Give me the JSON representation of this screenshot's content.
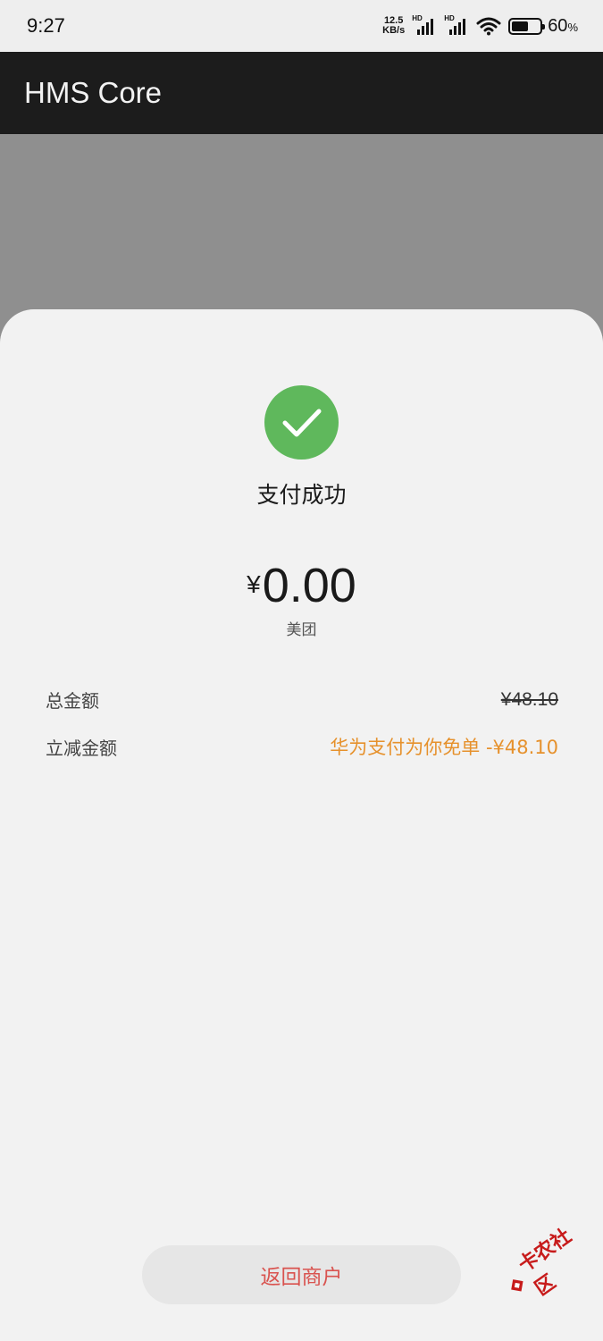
{
  "status_bar": {
    "time": "9:27",
    "net_speed_value": "12.5",
    "net_speed_unit": "KB/s",
    "signal_1_label": "HD",
    "signal_2_label": "HD",
    "battery_percent": "60",
    "battery_unit": "%",
    "battery_level": 0.6
  },
  "app_bar": {
    "title": "HMS Core"
  },
  "payment": {
    "status_text": "支付成功",
    "currency_symbol": "¥",
    "amount": "0.00",
    "merchant": "美团"
  },
  "details": {
    "total_label": "总金额",
    "total_value": "¥48.10",
    "discount_label": "立减金额",
    "discount_value": "华为支付为你免单 -¥48.10"
  },
  "actions": {
    "return_label": "返回商户"
  },
  "watermark": {
    "text": "卡农社区"
  },
  "colors": {
    "success_green": "#5fb85c",
    "discount_orange": "#e6912c",
    "return_red": "#d9534f",
    "watermark_red": "#c71b1b"
  }
}
